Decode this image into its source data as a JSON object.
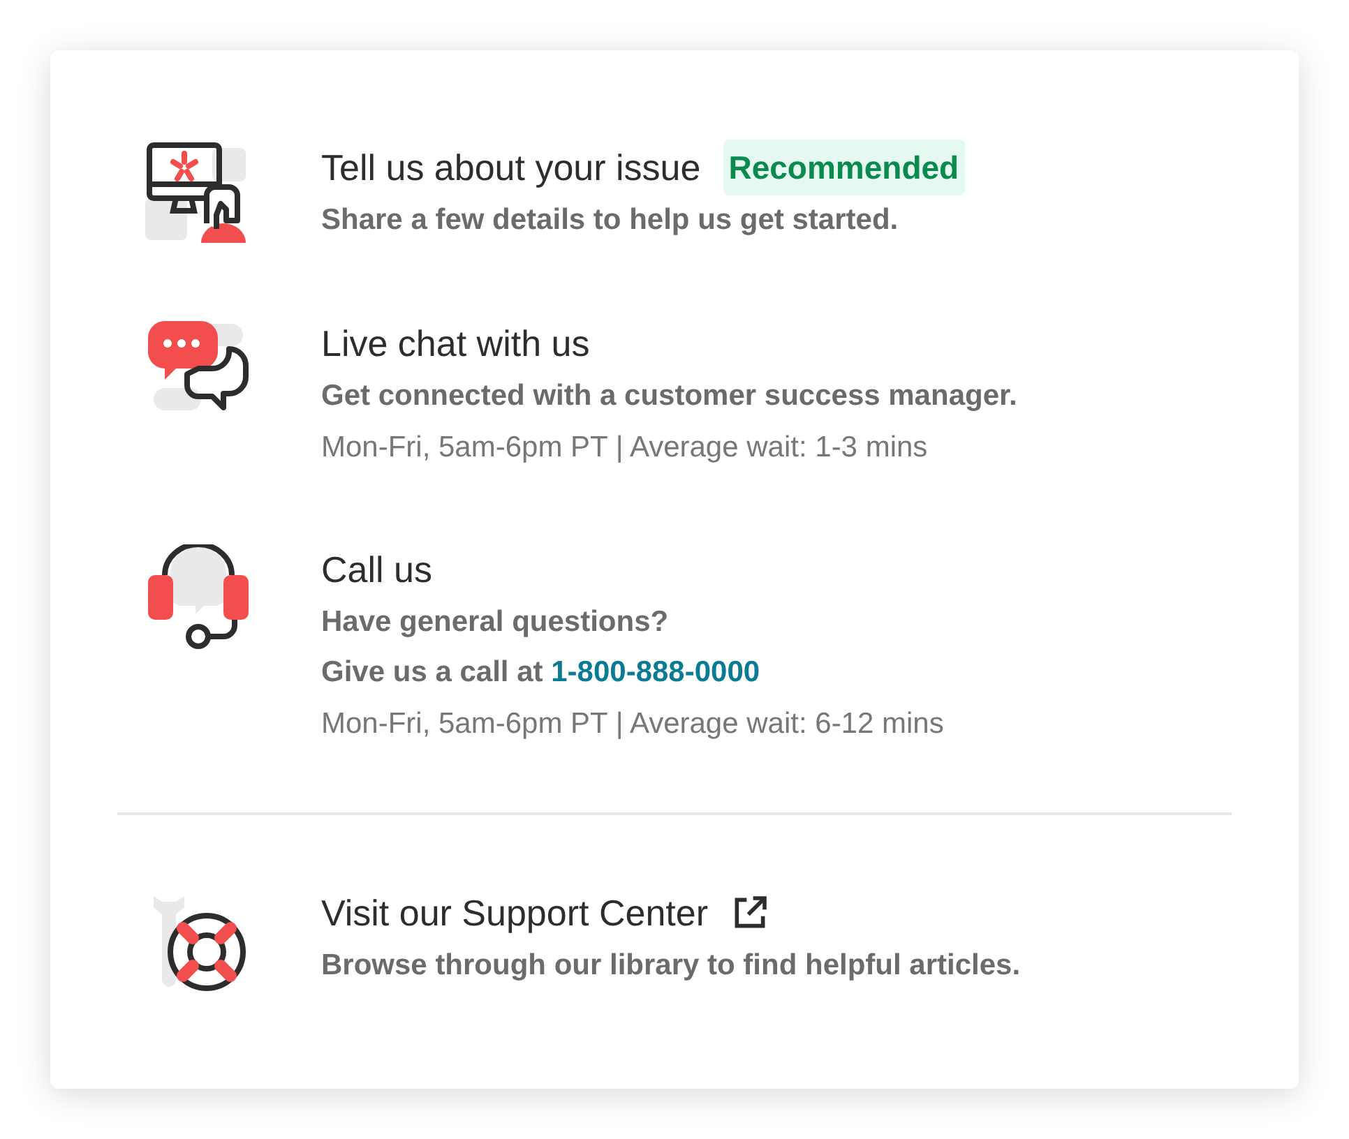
{
  "options": [
    {
      "kind": "issue",
      "title": "Tell us about your issue",
      "badge": "Recommended",
      "lines": [
        "Share a few details to help us get started."
      ]
    },
    {
      "kind": "chat",
      "title": "Live chat with us",
      "lines": [
        "Get connected with a customer success manager."
      ],
      "hours": "Mon-Fri, 5am-6pm PT | Average wait: 1-3 mins"
    },
    {
      "kind": "call",
      "title": "Call us",
      "lines": [
        "Have general questions?"
      ],
      "phone_prefix": "Give us a call at",
      "phone": "1-800-888-0000",
      "hours": "Mon-Fri, 5am-6pm PT | Average wait: 6-12 mins"
    }
  ],
  "support_center": {
    "kind": "support",
    "title": "Visit our Support Center",
    "lines": [
      "Browse through our library to find helpful articles."
    ]
  }
}
